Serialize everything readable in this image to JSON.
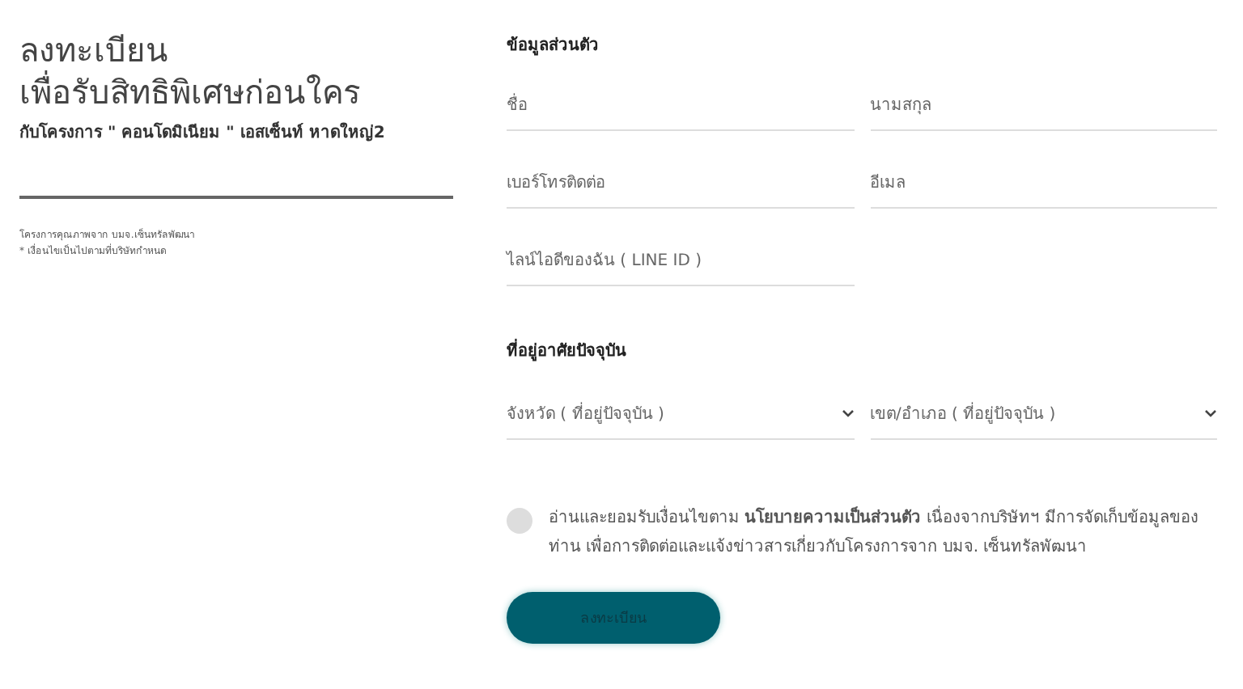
{
  "intro": {
    "title_lines": [
      "ลงทะเบียน",
      "เพื่อรับสิทธิพิเศษก่อนใคร"
    ],
    "subtitle": "กับโครงการ \" คอนโดมิเนียม \" เอสเซ็นท์ หาดใหญ่2",
    "notes": [
      "โครงการคุณภาพจาก บมจ.เซ็นทรัลพัฒนา",
      "* เงื่อนไขเป็นไปตามที่บริษัทกำหนด"
    ]
  },
  "personal": {
    "heading": "ข้อมูลส่วนตัว",
    "fields": [
      {
        "placeholder": "ชื่อ"
      },
      {
        "placeholder": "นามสกุล"
      },
      {
        "placeholder": "เบอร์โทรติดต่อ"
      },
      {
        "placeholder": "อีเมล"
      },
      {
        "placeholder": "ไลน์ไอดีของฉัน ( LINE ID )"
      }
    ]
  },
  "address": {
    "heading": "ที่อยู่อาศัยปัจจุบัน",
    "selects": [
      {
        "placeholder": "จังหวัด ( ที่อยู่ปัจจุบัน )"
      },
      {
        "placeholder": "เขต/อำเภอ ( ที่อยู่ปัจจุบัน )"
      }
    ]
  },
  "consent": {
    "checked": false,
    "text": "อ่านและยอมรับเงื่อนไขตาม **นโยบายความเป็นส่วนตัว** เนื่องจากบริษัทฯ มีการจัดเก็บข้อมูลของท่าน เพื่อการติดต่อและแจ้งข่าวสารเกี่ยวกับโครงการจาก บมจ. เซ็นทรัลพัฒนา"
  },
  "submit": {
    "label": "ลงทะเบียน"
  }
}
